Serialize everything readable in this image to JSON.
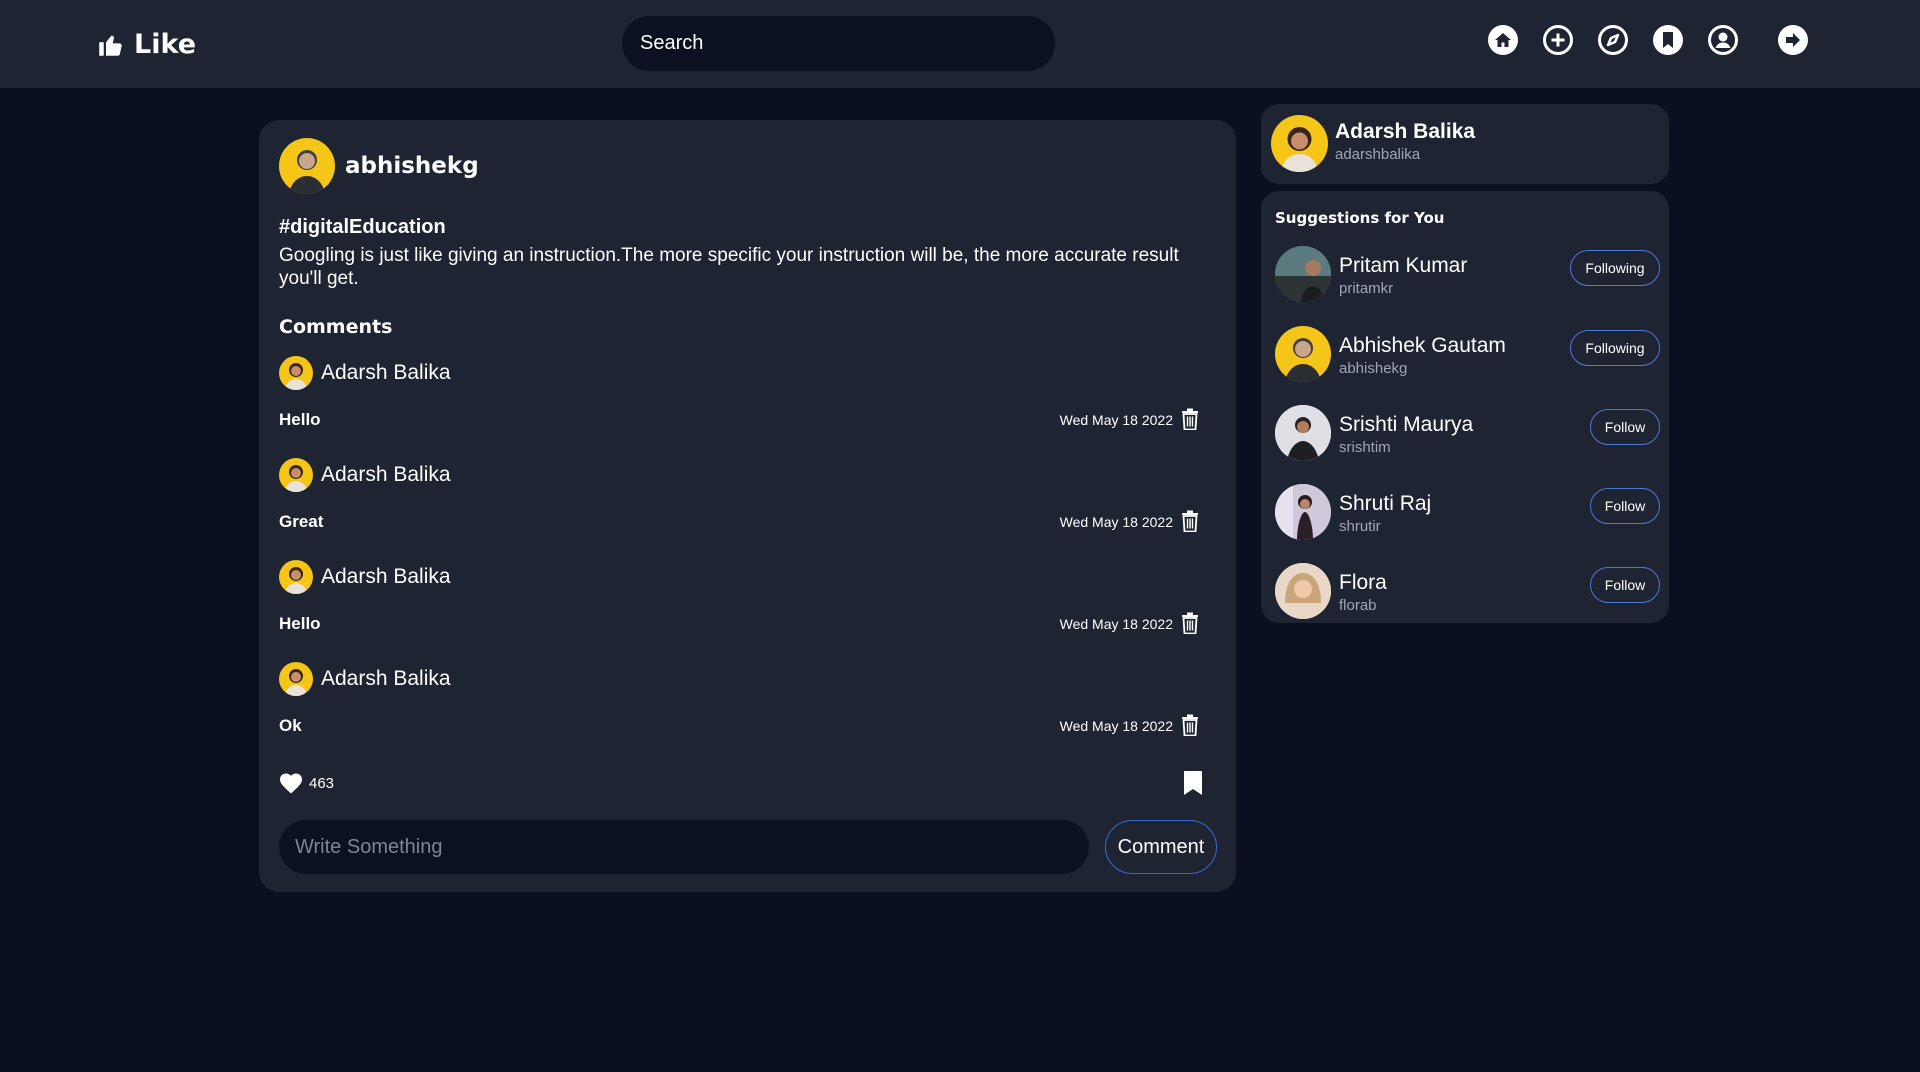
{
  "header": {
    "logo_text": "Like",
    "search_label": "Search",
    "nav_icons": [
      "home-icon",
      "add-post-icon",
      "explore-icon",
      "bookmarks-icon",
      "profile-icon",
      "logout-icon"
    ]
  },
  "post": {
    "author": "abhishekg",
    "hashtag": "#digitalEducation",
    "text": "Googling is just like giving an instruction.The more specific your instruction will be, the more accurate result you'll get.",
    "comments_title": "Comments",
    "comments": [
      {
        "user": "Adarsh Balika",
        "text": "Hello",
        "date": "Wed May 18 2022"
      },
      {
        "user": "Adarsh Balika",
        "text": "Great",
        "date": "Wed May 18 2022"
      },
      {
        "user": "Adarsh Balika",
        "text": "Hello",
        "date": "Wed May 18 2022"
      },
      {
        "user": "Adarsh Balika",
        "text": "Ok",
        "date": "Wed May 18 2022"
      }
    ],
    "likes": "463",
    "comment_placeholder": "Write Something",
    "comment_button": "Comment"
  },
  "profile": {
    "name": "Adarsh Balika",
    "handle": "adarshbalika"
  },
  "suggestions": {
    "title": "Suggestions for You",
    "items": [
      {
        "name": "Pritam Kumar",
        "handle": "pritamkr",
        "button": "Following"
      },
      {
        "name": "Abhishek Gautam",
        "handle": "abhishekg",
        "button": "Following"
      },
      {
        "name": "Srishti Maurya",
        "handle": "srishtim",
        "button": "Follow"
      },
      {
        "name": "Shruti Raj",
        "handle": "shrutir",
        "button": "Follow"
      },
      {
        "name": "Flora",
        "handle": "florab",
        "button": "Follow"
      }
    ]
  },
  "colors": {
    "background": "#0a1020",
    "panel": "#1e2432",
    "input": "#0b1120",
    "accent_border": "#4d7ad6",
    "avatar_yellow": "#f5c518"
  }
}
